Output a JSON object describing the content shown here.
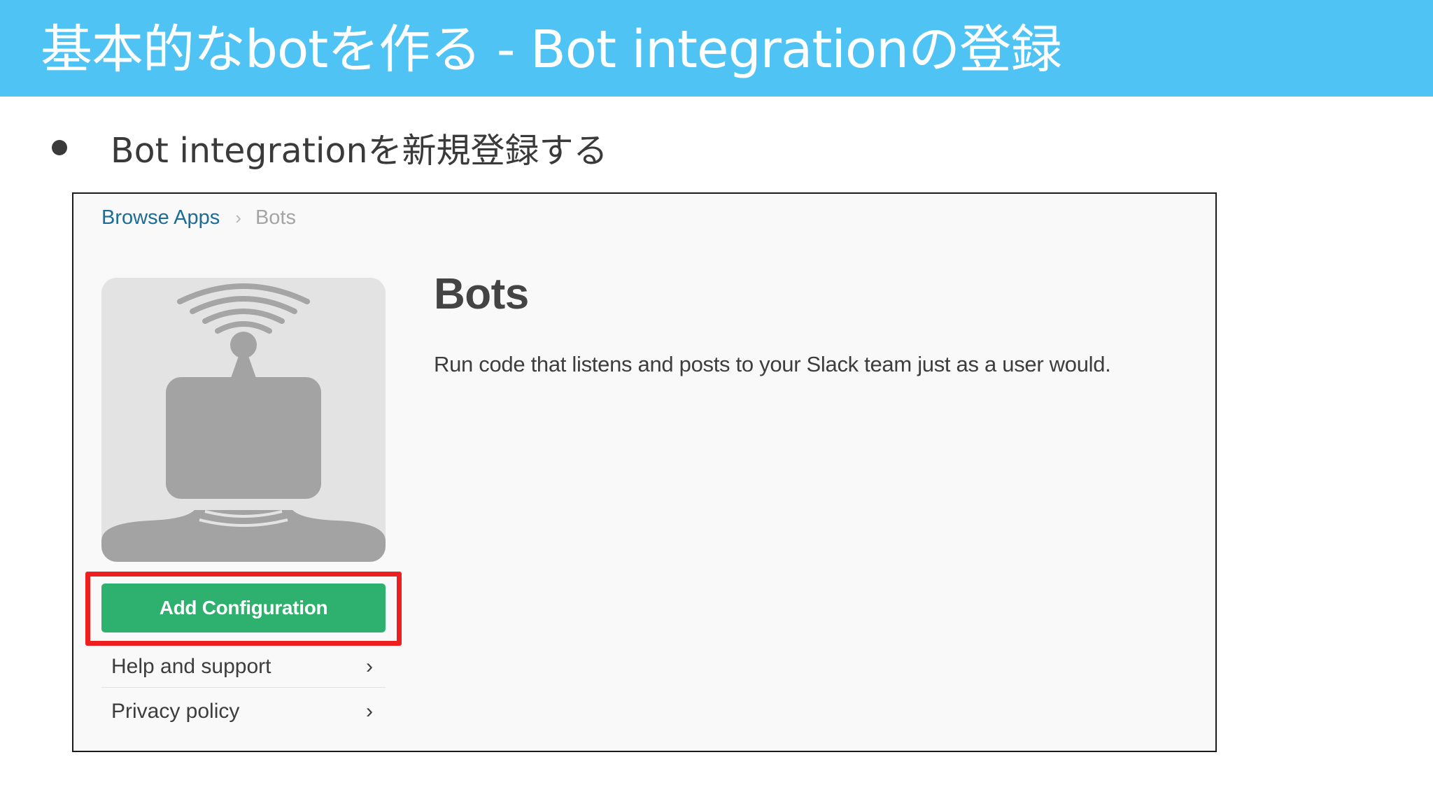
{
  "slide": {
    "title": "基本的なbotを作る - Bot integrationの登録",
    "bullet": "Bot integrationを新規登録する"
  },
  "screenshot": {
    "breadcrumb": {
      "link": "Browse Apps",
      "separator": "›",
      "current": "Bots"
    },
    "app": {
      "icon": "robot-antenna-icon",
      "title": "Bots",
      "description": "Run code that listens and posts to your Slack team just as a user would."
    },
    "primary_button": "Add Configuration",
    "links": [
      {
        "label": "Help and support",
        "chevron": "›"
      },
      {
        "label": "Privacy policy",
        "chevron": "›"
      }
    ]
  },
  "colors": {
    "title_bar": "#4fc3f4",
    "button": "#2eb06e",
    "highlight": "#ee1f1f",
    "link": "#1b6c96"
  }
}
